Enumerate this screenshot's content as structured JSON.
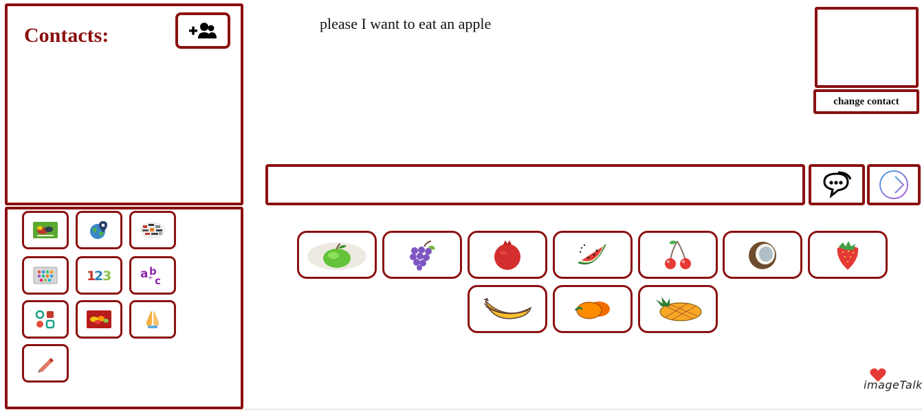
{
  "contacts": {
    "title": "Contacts:",
    "add_button_icon": "add-users-icon"
  },
  "sentence": {
    "text": "please I want to eat an apple"
  },
  "contact_card": {
    "change_label": "change contact"
  },
  "composer": {
    "input_value": "",
    "speak_icon": "speech-bubble-icon",
    "send_icon": "arrow-right-circle-icon"
  },
  "categories": [
    {
      "name": "food-category",
      "icon": "food-icon"
    },
    {
      "name": "places-category",
      "icon": "globe-pin-icon"
    },
    {
      "name": "people-category",
      "icon": "people-collage-icon"
    },
    {
      "name": "tablet-category",
      "icon": "tablet-apps-icon"
    },
    {
      "name": "numbers-category",
      "label": "123",
      "icon": "numbers-icon"
    },
    {
      "name": "letters-category",
      "label": "abc",
      "icon": "letters-icon"
    },
    {
      "name": "activities-category",
      "icon": "activities-icon"
    },
    {
      "name": "fruits-category",
      "icon": "fruit-basket-icon"
    },
    {
      "name": "prayer-category",
      "icon": "praying-hands-icon"
    },
    {
      "name": "draw-category",
      "icon": "pencil-icon"
    }
  ],
  "fruits": [
    {
      "name": "apple",
      "icon": "apple-icon"
    },
    {
      "name": "grapes",
      "icon": "grapes-icon"
    },
    {
      "name": "pomegranate",
      "icon": "pomegranate-icon"
    },
    {
      "name": "watermelon",
      "icon": "watermelon-icon"
    },
    {
      "name": "cherry",
      "icon": "cherry-icon"
    },
    {
      "name": "coconut",
      "icon": "coconut-icon"
    },
    {
      "name": "strawberry",
      "icon": "strawberry-icon"
    },
    {
      "name": "banana",
      "icon": "banana-icon"
    },
    {
      "name": "orange",
      "icon": "orange-icon"
    },
    {
      "name": "pineapple",
      "icon": "pineapple-icon"
    }
  ],
  "branding": {
    "logo_text": "imageTalk"
  },
  "colors": {
    "accent": "#8b1010"
  }
}
